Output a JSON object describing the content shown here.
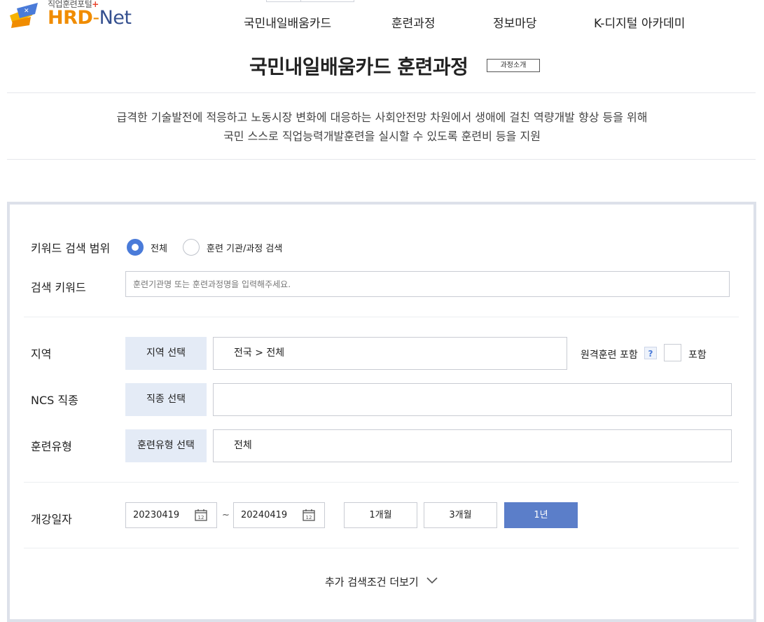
{
  "header": {
    "logo_sub": "직업훈련포털",
    "logo_plus": "+",
    "logo_hrd": "HRD",
    "logo_dash": "-",
    "logo_net": "Net",
    "nav": [
      "국민내일배움카드",
      "훈련과정",
      "정보마당",
      "K-디지털 아카데미"
    ]
  },
  "page": {
    "title": "국민내일배움카드 훈련과정",
    "badge": "과정소개",
    "intro_line1": "급격한 기술발전에 적응하고 노동시장 변화에 대응하는 사회안전망 차원에서 생애에 걸친 역량개발 향상 등을 위해",
    "intro_line2": "국민 스스로 직업능력개발훈련을 실시할 수 있도록 훈련비 등을 지원"
  },
  "search": {
    "scope_label": "키워드 검색 범위",
    "scope_options": [
      "전체",
      "훈련 기관/과정 검색"
    ],
    "scope_selected": "전체",
    "keyword_label": "검색 키워드",
    "keyword_placeholder": "훈련기관명 또는 훈련과정명을 입력해주세요.",
    "keyword_value": "",
    "region_label": "지역",
    "region_button": "지역 선택",
    "region_value": "전국 > 전체",
    "remote_label": "원격훈련 포함",
    "remote_help": "?",
    "remote_check_label": "포함",
    "remote_checked": false,
    "ncs_label": "NCS 직종",
    "ncs_button": "직종 선택",
    "ncs_value": "",
    "type_label": "훈련유형",
    "type_button": "훈련유형 선택",
    "type_value": "전체",
    "date_label": "개강일자",
    "date_from": "20230419",
    "date_sep": "~",
    "date_to": "20240419",
    "periods": [
      "1개월",
      "3개월",
      "1년"
    ],
    "period_active": "1년",
    "more_label": "추가 검색조건 더보기"
  },
  "colors": {
    "accent": "#4a7bd9",
    "active_button": "#5b7ec9",
    "select_button_bg": "#e4ebf6",
    "logo_orange": "#f08c00",
    "logo_navy": "#35508f"
  }
}
